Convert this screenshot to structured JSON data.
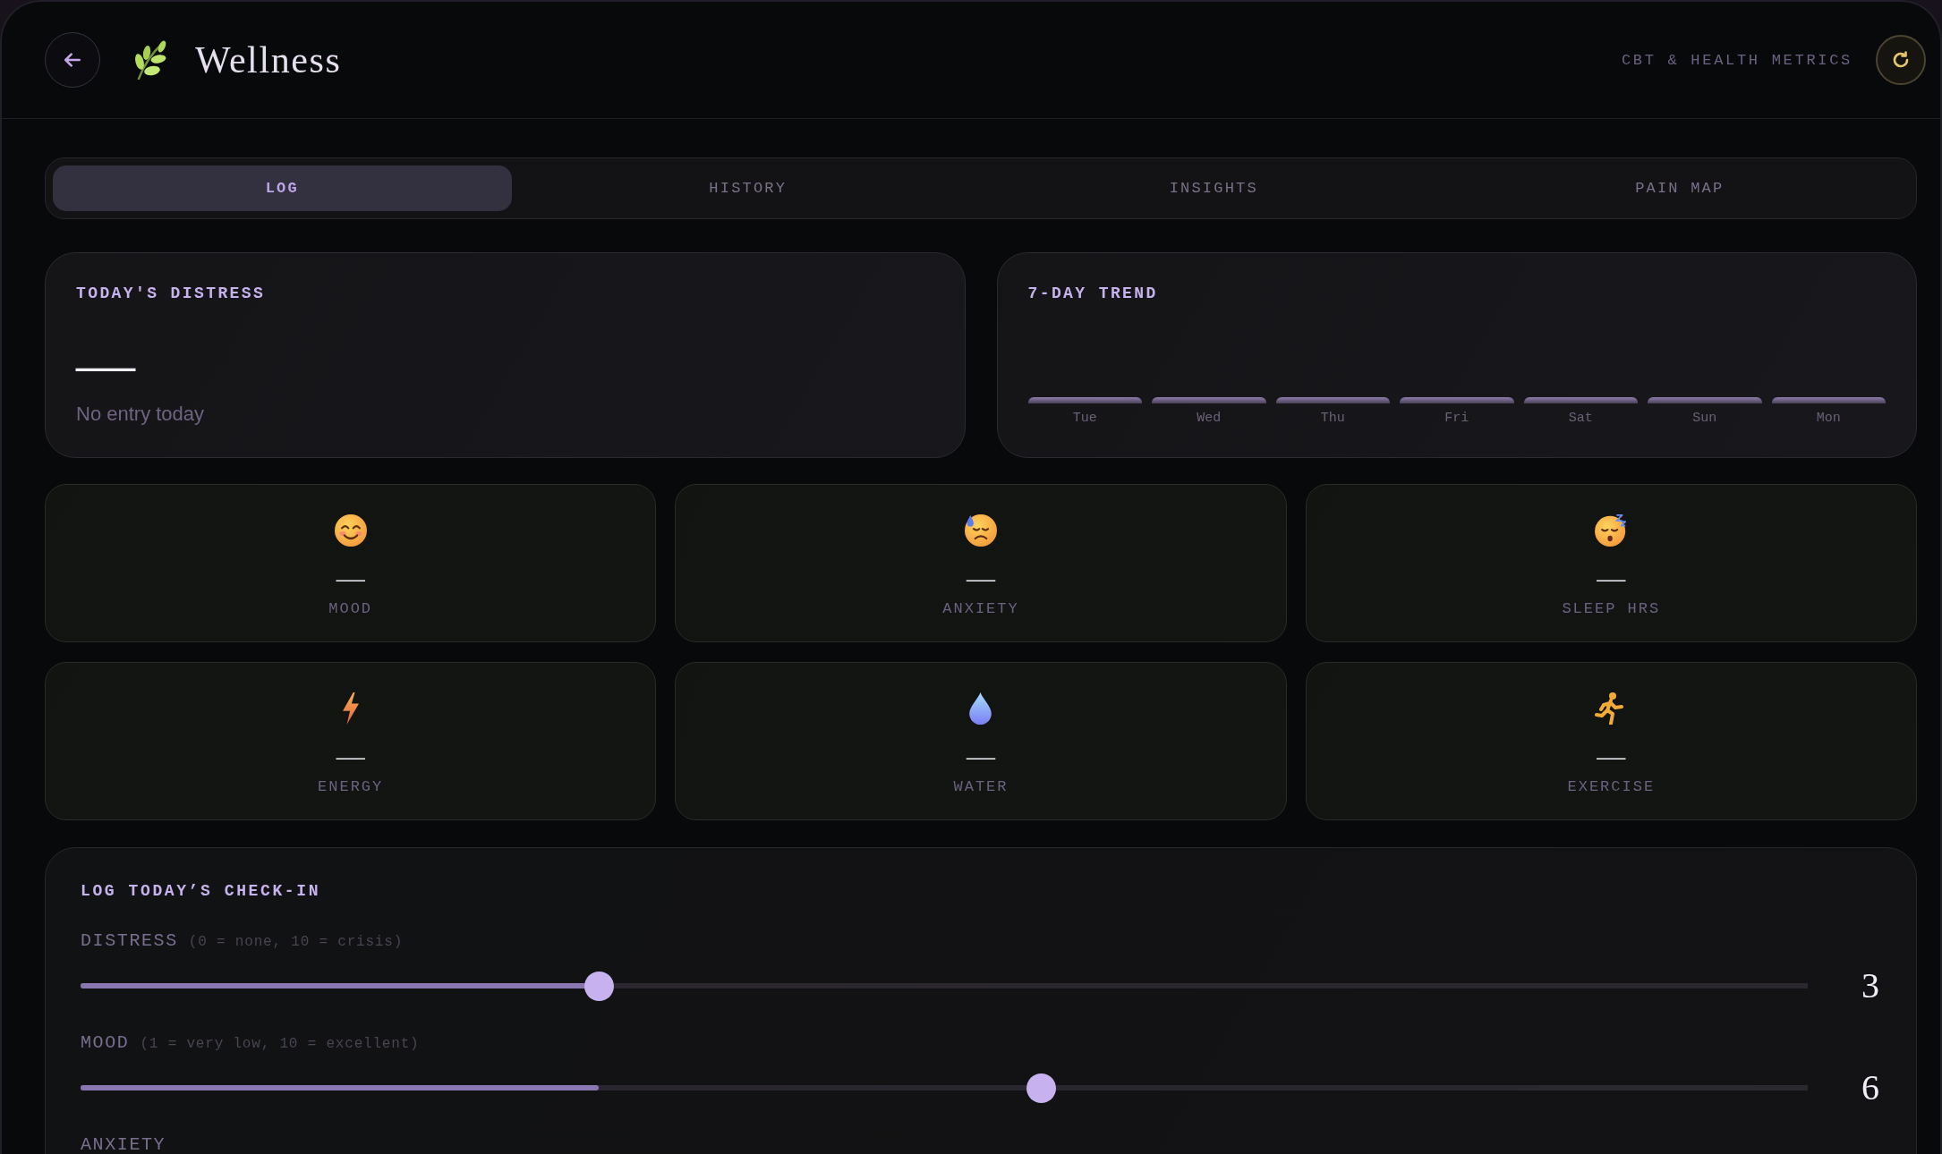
{
  "header": {
    "title": "Wellness",
    "subtitle": "CBT & HEALTH METRICS"
  },
  "tabs": [
    {
      "label": "LOG",
      "selected": true
    },
    {
      "label": "HISTORY",
      "selected": false
    },
    {
      "label": "INSIGHTS",
      "selected": false
    },
    {
      "label": "PAIN MAP",
      "selected": false
    }
  ],
  "distress_card": {
    "title": "TODAY'S DISTRESS",
    "value": "—",
    "message": "No entry today"
  },
  "trend_card": {
    "title": "7-DAY TREND",
    "days": [
      "Tue",
      "Wed",
      "Thu",
      "Fri",
      "Sat",
      "Sun",
      "Mon"
    ]
  },
  "metrics": [
    {
      "kind": "mood",
      "value": "—",
      "label": "MOOD"
    },
    {
      "kind": "anxiety",
      "value": "—",
      "label": "ANXIETY"
    },
    {
      "kind": "sleep",
      "value": "—",
      "label": "SLEEP HRS"
    },
    {
      "kind": "energy",
      "value": "—",
      "label": "ENERGY"
    },
    {
      "kind": "water",
      "value": "—",
      "label": "WATER"
    },
    {
      "kind": "exercise",
      "value": "—",
      "label": "EXERCISE"
    }
  ],
  "checkin": {
    "title": "LOG TODAY’S CHECK-IN",
    "sliders": [
      {
        "label": "DISTRESS",
        "hint": "(0 = none, 10 = crisis)",
        "value": "3",
        "fill": {
          "level": 0.3
        },
        "thumb": {
          "level": 0.3
        }
      },
      {
        "label": "MOOD",
        "hint": "(1 = very low, 10 = excellent)",
        "value": "6",
        "fill": {
          "level": 0.3
        },
        "thumb": {
          "level": 0.556
        }
      },
      {
        "label": "ANXIETY"
      }
    ]
  }
}
